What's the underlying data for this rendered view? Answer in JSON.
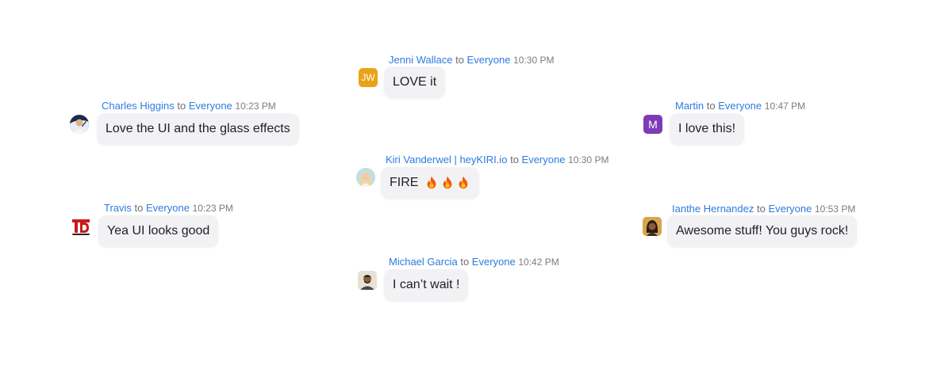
{
  "messages": [
    {
      "sender": "Jenni Wallace",
      "to": "to",
      "recipient": "Everyone",
      "time": "10:30 PM",
      "text": "LOVE it",
      "initials": "JW",
      "avatar_color": "#e8a317"
    },
    {
      "sender": "Charles Higgins",
      "to": "to",
      "recipient": "Everyone",
      "time": "10:23 PM",
      "text": "Love the UI and the glass effects"
    },
    {
      "sender": "Martin",
      "to": "to",
      "recipient": "Everyone",
      "time": "10:47 PM",
      "text": "I love this!",
      "initials": "M",
      "avatar_color": "#7d3bb8"
    },
    {
      "sender": "Kiri Vanderwel | heyKIRI.io",
      "to": "to",
      "recipient": "Everyone",
      "time": "10:30 PM",
      "text": "FIRE"
    },
    {
      "sender": "Travis",
      "to": "to",
      "recipient": "Everyone",
      "time": "10:23 PM",
      "text": "Yea UI looks good"
    },
    {
      "sender": "Ianthe Hernandez",
      "to": "to",
      "recipient": "Everyone",
      "time": "10:53 PM",
      "text": "Awesome stuff! You guys rock!"
    },
    {
      "sender": "Michael Garcia",
      "to": "to",
      "recipient": "Everyone",
      "time": "10:42 PM",
      "text": "I can’t wait !"
    }
  ],
  "colors": {
    "link_blue": "#2d7be0",
    "bubble_bg": "#f2f2f5",
    "fire_emoji": "#f25c05"
  }
}
